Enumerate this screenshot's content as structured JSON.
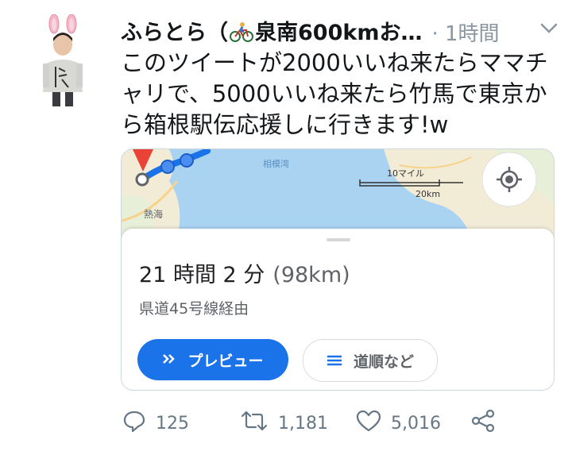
{
  "tweet": {
    "author_name_prefix": "ふらとら（",
    "author_name_suffix": "泉南600kmお…",
    "time": "· 1時間",
    "text": "このツイートが2000いいね来たらママチャリで、5000いいね来たら竹馬で東京から箱根駅伝応援しに行きます!w",
    "avatar_shirt_text": "陰キャ"
  },
  "map_card": {
    "map_labels": {
      "sea": "相模湾",
      "town": "熱海",
      "scale_miles": "10マイル",
      "scale_km": "20km"
    },
    "duration": "21 時間 2 分",
    "distance": "(98km)",
    "via": "県道45号線経由",
    "preview_label": "プレビュー",
    "steps_label": "道順など"
  },
  "actions": {
    "replies": "125",
    "retweets": "1,181",
    "likes": "5,016"
  },
  "colors": {
    "accent": "#1a73e8",
    "map_water": "#aad3f2",
    "map_land": "#f2ecd6",
    "icon_gray": "#657786"
  },
  "icons": [
    "bicycle-icon",
    "chevron-down-icon",
    "my-location-icon",
    "reply-icon",
    "retweet-icon",
    "like-icon",
    "share-icon",
    "list-icon",
    "chevrons-right-icon"
  ]
}
